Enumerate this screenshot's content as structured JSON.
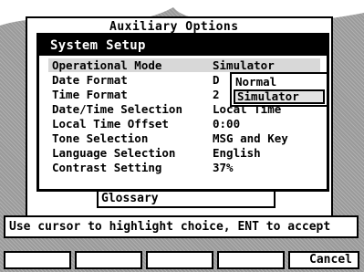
{
  "aux_window": {
    "title": "Auxiliary Options",
    "glossary_label": "Glossary"
  },
  "system_setup": {
    "title": "System Setup",
    "rows": [
      {
        "label": "Operational Mode",
        "value": "Simulator"
      },
      {
        "label": "Date Format",
        "value": "D"
      },
      {
        "label": "Time Format",
        "value": "2"
      },
      {
        "label": "Date/Time Selection",
        "value": "Local Time"
      },
      {
        "label": "Local Time Offset",
        "value": "0:00"
      },
      {
        "label": "Tone Selection",
        "value": "MSG and Key"
      },
      {
        "label": "Language Selection",
        "value": "English"
      },
      {
        "label": "Contrast Setting",
        "value": "37%"
      }
    ]
  },
  "dropdown": {
    "options": [
      "Normal",
      "Simulator"
    ],
    "selected": "Simulator"
  },
  "prompt": "Use cursor to highlight choice, ENT to accept",
  "softkeys": [
    "",
    "",
    "",
    "",
    "Cancel"
  ]
}
